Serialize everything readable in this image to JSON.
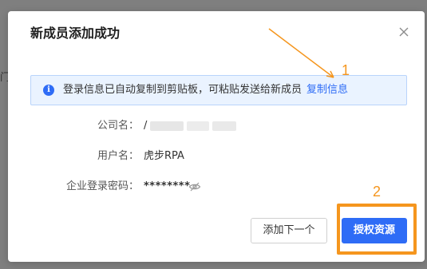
{
  "dialog": {
    "title": "新成员添加成功",
    "close_icon": "close-icon"
  },
  "info_banner": {
    "icon": "info-icon",
    "icon_glyph": "i",
    "message": "登录信息已自动复制到剪贴板，可粘贴发送给新成员",
    "copy_link": "复制信息"
  },
  "fields": {
    "company": {
      "label": "公司名：",
      "value": "/"
    },
    "username": {
      "label": "用户名：",
      "value": "虎步RPA"
    },
    "password": {
      "label": "企业登录密码：",
      "value": "********",
      "toggle_icon": "eye-off-icon"
    }
  },
  "buttons": {
    "add_next": "添加下一个",
    "authorize": "授权资源"
  },
  "annotations": {
    "one": "1",
    "two": "2",
    "color": "#f5961e"
  },
  "colors": {
    "primary": "#2e6cf6",
    "banner_bg": "#eaf3ff"
  }
}
